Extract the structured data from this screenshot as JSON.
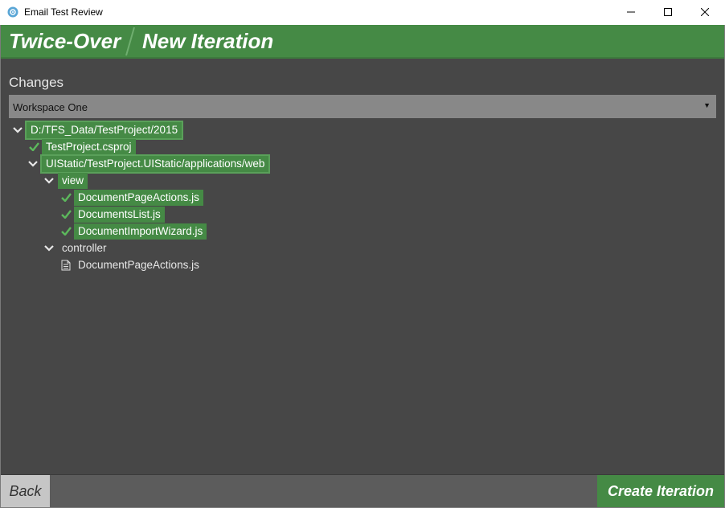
{
  "window": {
    "title": "Email Test Review",
    "icon": "app-gear-icon",
    "controls": [
      "minimize-icon",
      "maximize-icon",
      "close-icon"
    ]
  },
  "header": {
    "app_name": "Twice-Over",
    "page_title": "New Iteration",
    "accent": "#458a45"
  },
  "changes": {
    "label": "Changes",
    "workspace_select": {
      "value": "Workspace One",
      "arrow": "▼"
    }
  },
  "tree": [
    {
      "label": "D:/TFS_Data/TestProject/2015",
      "level": 0,
      "expander": "expanded",
      "style": "outlined",
      "icon": "chevron-down-icon"
    },
    {
      "label": "TestProject.csproj",
      "level": 1,
      "expander": "none",
      "style": "filled",
      "icon": "check-icon"
    },
    {
      "label": "UIStatic/TestProject.UIStatic/applications/web",
      "level": 1,
      "expander": "expanded",
      "style": "outlined",
      "icon": "chevron-down-icon"
    },
    {
      "label": "view",
      "level": 2,
      "expander": "expanded",
      "style": "filled",
      "icon": "chevron-down-icon"
    },
    {
      "label": "DocumentPageActions.js",
      "level": 3,
      "expander": "none",
      "style": "filled",
      "icon": "check-icon"
    },
    {
      "label": "DocumentsList.js",
      "level": 3,
      "expander": "none",
      "style": "filled",
      "icon": "check-icon"
    },
    {
      "label": "DocumentImportWizard.js",
      "level": 3,
      "expander": "none",
      "style": "filled",
      "icon": "check-icon"
    },
    {
      "label": "controller",
      "level": 2,
      "expander": "expanded",
      "style": "plain",
      "icon": "chevron-down-icon"
    },
    {
      "label": "DocumentPageActions.js",
      "level": 3,
      "expander": "none",
      "style": "plain",
      "icon": "file-icon"
    }
  ],
  "footer": {
    "back_label": "Back",
    "create_label": "Create Iteration"
  }
}
